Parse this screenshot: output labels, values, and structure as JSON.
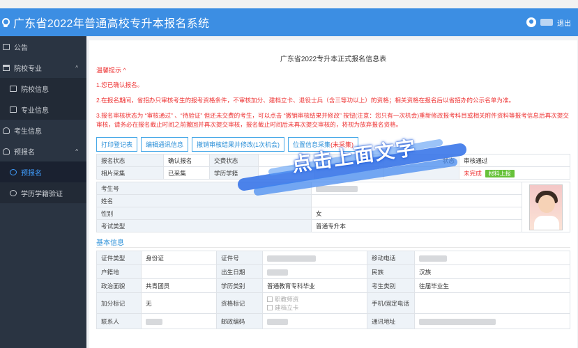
{
  "header": {
    "title": "广东省2022年普通高校专升本报名系统",
    "logout": "退出"
  },
  "sidebar": {
    "items": [
      {
        "label": "公告",
        "icon": "document-icon"
      },
      {
        "label": "院校专业",
        "icon": "graduation-cap-icon",
        "expanded": true
      },
      {
        "label": "院校信息",
        "icon": "document-icon",
        "sub": true
      },
      {
        "label": "专业信息",
        "icon": "document-icon",
        "sub": true
      },
      {
        "label": "考生信息",
        "icon": "user-icon"
      },
      {
        "label": "预报名",
        "icon": "user-icon",
        "expanded": true
      },
      {
        "label": "预报名",
        "icon": "eye-icon",
        "sub": true,
        "active": true
      },
      {
        "label": "学历学籍验证",
        "icon": "eye-icon",
        "sub": true
      }
    ]
  },
  "form": {
    "title": "广东省2022专升本正式报名信息表",
    "tips_head": "温馨提示 ^",
    "tips": [
      "1.您已确认报名。",
      "2.在报名期间，省招办只审核考生的报考资格条件，不审核加分、建档立卡、退役士兵（含三等功以上）的资格；相关资格在报名后以省招办的公示名单为准。",
      "3.报名审核状态为 “审核通过” 、“待验证” 但还未交费的考生，可以点击 “撤销审核结果并修改” 按钮(注意：您只有一次机会)重新修改报考科目或相关附件资料等报考信息后再次提交审核，请务必在报名截止时间之前撤回并再次提交审核，报名截止时间后未再次提交审核的，将视为放弃报名资格。"
    ],
    "buttons": [
      "打印登记表",
      "编辑通讯信息",
      "撤销审核结果并修改(1次机会)"
    ],
    "photo_button": {
      "text": "位置信息采集",
      "note": "(未采集)"
    },
    "status_row1": {
      "l1": "报名状态",
      "v1": "确认报名",
      "l2": "交费状态",
      "l3": "状态",
      "v3": "审核通过"
    },
    "status_row2": {
      "l1": "相片采集",
      "v1": "已采集",
      "l2": "学历学籍",
      "v3": "未完成",
      "badge": "材料上报"
    },
    "personal": [
      {
        "label": "考生号",
        "value": ""
      },
      {
        "label": "姓名",
        "value": ""
      },
      {
        "label": "性别",
        "value": "女"
      },
      {
        "label": "考试类型",
        "value": "普通专升本"
      }
    ],
    "basic_title": "基本信息",
    "basic_rows": [
      [
        "证件类型",
        "身份证",
        "证件号",
        "",
        "移动电话",
        ""
      ],
      [
        "户籍地",
        "",
        "出生日期",
        "",
        "民族",
        "汉族"
      ],
      [
        "政治面貌",
        "共青团员",
        "学历类别",
        "普通教育专科毕业",
        "考生类别",
        "往届毕业生"
      ],
      [
        "加分标记",
        "无",
        "资格标记",
        "",
        "手机/固定电话",
        ""
      ],
      [
        "联系人",
        "",
        "邮政编码",
        "",
        "通讯地址",
        ""
      ]
    ],
    "qualification_options": [
      "职教师资",
      "建档立卡"
    ]
  },
  "overlay": {
    "text": "点击上面文字"
  }
}
